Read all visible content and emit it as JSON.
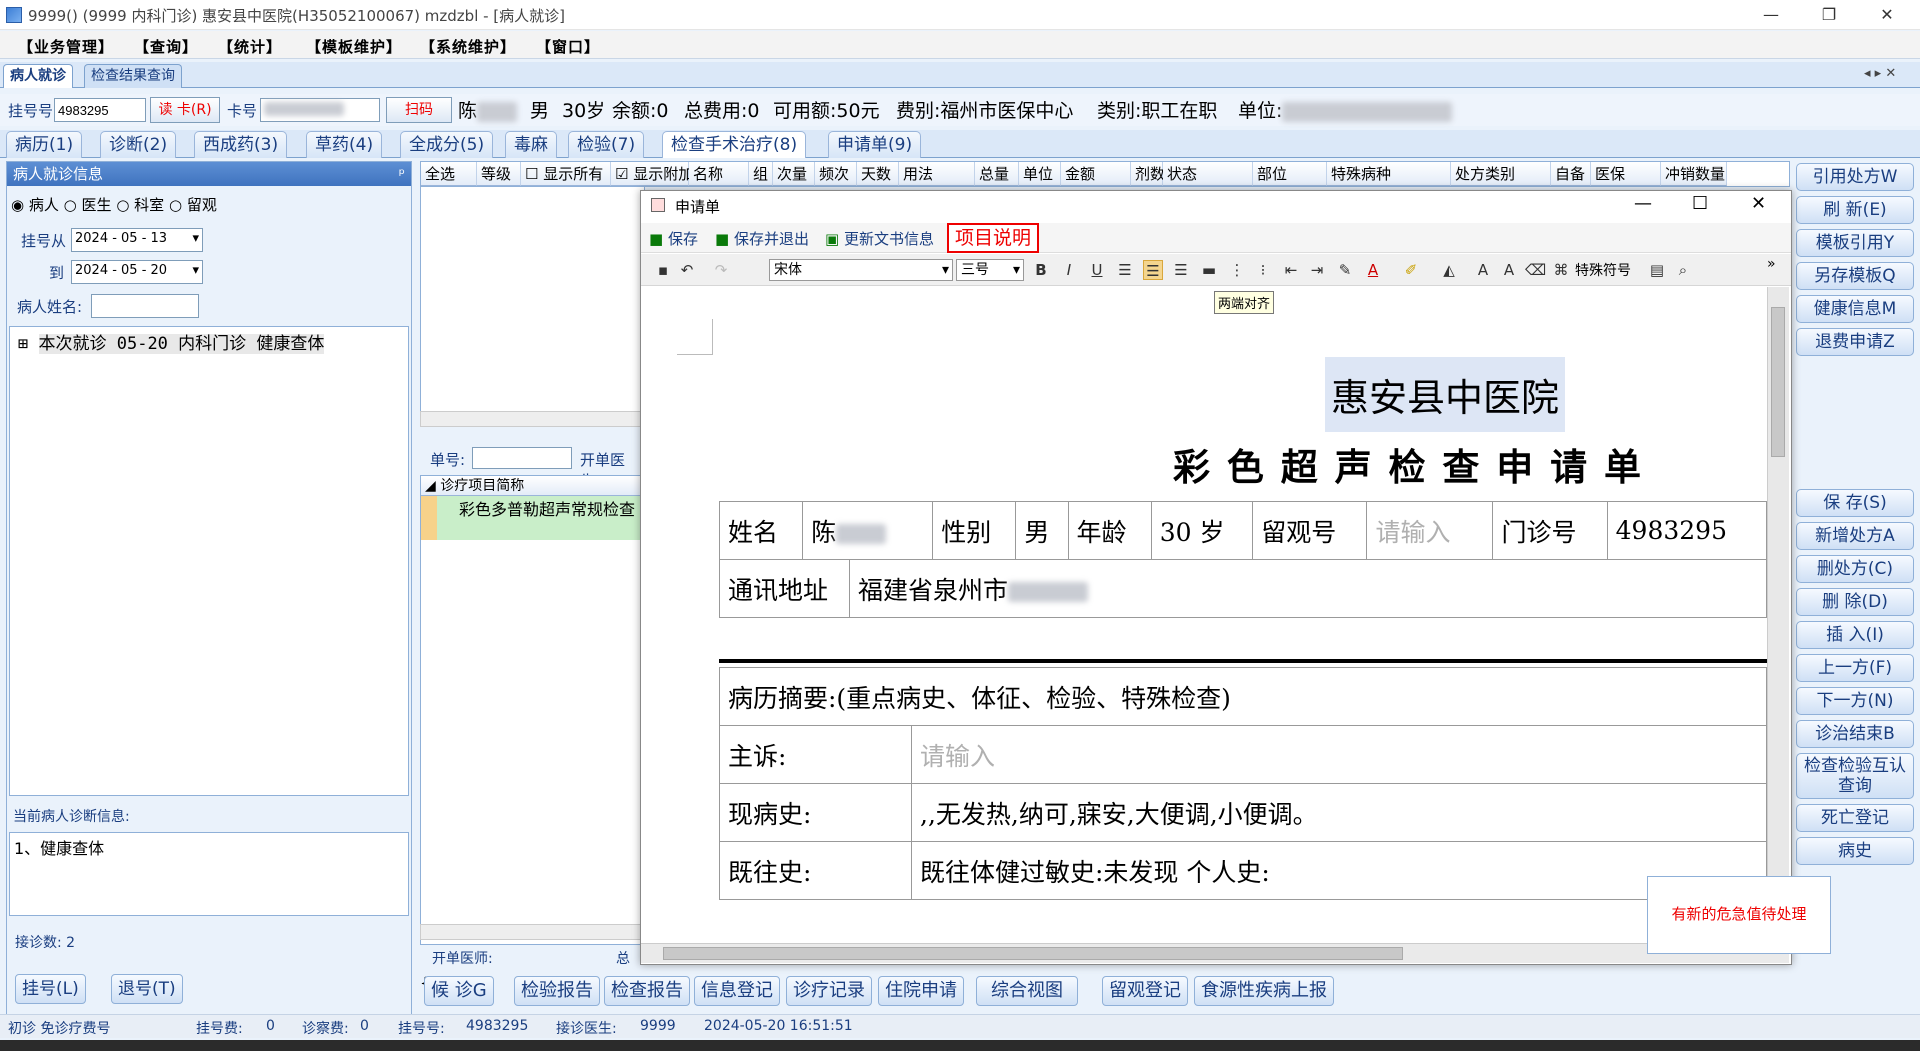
{
  "window": {
    "title": "9999() (9999 内科门诊) 惠安县中医院(H35052100067) mzdzbl - [病人就诊]",
    "min": "—",
    "restore": "❐",
    "close": "✕"
  },
  "menu": [
    "【业务管理】",
    "【查询】",
    "【统计】",
    "【模板维护】",
    "【系统维护】",
    "【窗口】"
  ],
  "page_tabs": [
    "病人就诊",
    "检查结果查询"
  ],
  "page_tab_controls": "◂ ▸ ✕",
  "registration": {
    "reg_label": "挂号号",
    "reg_no": "4983295",
    "read_card": "读 卡(R)",
    "card_label": "卡号",
    "scan": "扫码",
    "patient_name": "陈",
    "gender": "男",
    "age": "30岁",
    "balance": "余额:0",
    "total_fee": "总费用:0",
    "available": "可用额:50元",
    "fee_type": "费别:福州市医保中心",
    "category": "类别:职工在职",
    "unit_label": "单位:"
  },
  "sub_tabs": [
    "病历(1)",
    "诊断(2)",
    "西成药(3)",
    "草药(4)",
    "全成分(5)",
    "毒麻",
    "检验(7)",
    "检查手术治疗(8)",
    "申请单(9)"
  ],
  "left_panel": {
    "header": "病人就诊信息",
    "pin": "ᵖ",
    "radios": [
      "病人",
      "医生",
      "科室",
      "留观"
    ],
    "date_from_label": "挂号从",
    "date_from": "2024 - 05 - 13",
    "date_to_label": "到",
    "date_to": "2024 - 05 - 20",
    "name_label": "病人姓名:",
    "visit_item": "本次就诊  05-20  内科门诊  健康查体",
    "diag_header": "当前病人诊断信息:",
    "diag_text": "1、健康查体",
    "count_label": "接诊数: 2",
    "btn_register": "挂号(L)",
    "btn_unregister": "退号(T)"
  },
  "order_grid": {
    "headers": [
      "全选",
      "等级",
      "显示所有",
      "显示附加",
      "名称",
      "组",
      "次量",
      "频次",
      "天数",
      "用法",
      "总量",
      "单位",
      "金额",
      "剂数",
      "状态",
      "部位",
      "特殊病种",
      "处方类别",
      "自备",
      "医保",
      "冲销数量"
    ]
  },
  "apply_grid": {
    "single_no_label": "单号:",
    "doctor_label": "开单医生:",
    "col": "诊疗项目简称",
    "row": "彩色多普勒超声常规检查",
    "footer_doctor": "开单医师:",
    "footer_total": "总"
  },
  "right_buttons": [
    "引用处方W",
    "刷 新(E)",
    "模板引用Y",
    "另存模板Q",
    "健康信息M",
    "退费申请Z",
    "保 存(S)",
    "新增处方A",
    "删处方(C)",
    "删 除(D)",
    "插 入(I)",
    "上一方(F)",
    "下一方(N)",
    "诊治结束B",
    "检查检验互认查询",
    "死亡登记",
    "病史"
  ],
  "bottom_buttons": [
    "候 诊G",
    "检验报告",
    "检查报告",
    "信息登记",
    "诊疗记录",
    "住院申请",
    "综合视图",
    "留观登记",
    "食源性疾病上报"
  ],
  "status": {
    "visit_type": "初诊 免诊疗费号",
    "reg_fee_label": "挂号费:",
    "reg_fee": "0",
    "diag_fee_label": "诊察费:",
    "diag_fee": "0",
    "reg_no_label": "挂号号:",
    "reg_no": "4983295",
    "doctor_label": "接诊医生:",
    "doctor": "9999",
    "datetime": "2024-05-20 16:51:51"
  },
  "dialog": {
    "title": "申请单",
    "save": "保存",
    "save_exit": "保存并退出",
    "update_doc": "更新文书信息",
    "item_desc": "项目说明",
    "font": "宋体",
    "size": "三号",
    "special_chars": "特殊符号",
    "tooltip": "两端对齐",
    "more": "»",
    "hospital": "惠安县中医院",
    "form_title": "彩 色 超 声 检 查 申 请 单",
    "name_label": "姓名",
    "name_val": "陈",
    "sex_label": "性别",
    "sex_val": "男",
    "age_label": "年龄",
    "age_val": "30 岁",
    "obs_label": "留观号",
    "obs_placeholder": "请输入",
    "outpatient_label": "门诊号",
    "outpatient_val": "4983295",
    "address_label": "通讯地址",
    "address_val": "福建省泉州市",
    "summary": "病历摘要:(重点病史、体征、检验、特殊检查)",
    "complaint_label": "主诉:",
    "complaint_placeholder": "请输入",
    "present_label": "现病史:",
    "present_val": ",,无发热,纳可,寐安,大便调,小便调。",
    "past_label": "既往史:",
    "past_val": "既往体健过敏史:未发现 个人史:"
  },
  "toast": "有新的危急值待处理"
}
